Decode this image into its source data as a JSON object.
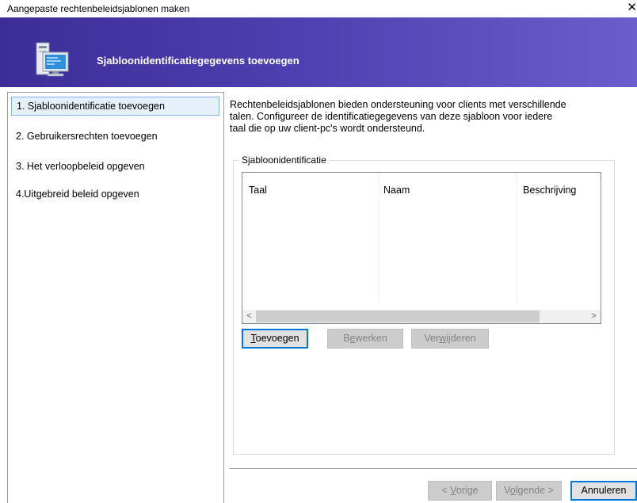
{
  "window": {
    "title": "Aangepaste rechtenbeleidsjablonen maken",
    "close_glyph": "✕"
  },
  "banner": {
    "icon": "computer-icon",
    "title": "Sjabloonidentificatiegegevens toevoegen",
    "gradient_start": "#3c2d97",
    "gradient_end": "#6b5dcc"
  },
  "sidebar": {
    "items": [
      {
        "label": "1. Sjabloonidentificatie toevoegen",
        "active": true
      },
      {
        "label": "2. Gebruikersrechten toevoegen",
        "active": false
      },
      {
        "label": "3. Het verloopbeleid opgeven",
        "active": false
      },
      {
        "label": "4.Uitgebreid beleid opgeven",
        "active": false
      }
    ]
  },
  "main": {
    "description_lines": [
      "Rechtenbeleidsjablonen bieden ondersteuning voor clients met verschillende",
      "talen. Configureer de identificatiegegevens van deze sjabloon voor iedere",
      "taal die op uw client-pc's wordt ondersteund."
    ],
    "group_label": "Sjabloonidentificatie",
    "columns": [
      "Taal",
      "Naam",
      "Beschrijving"
    ],
    "rows": [],
    "scroll_left": "<",
    "scroll_right": ">",
    "buttons": {
      "add": {
        "mnemonic": "T",
        "rest": "oevoegen",
        "enabled": true
      },
      "edit": {
        "before": "B",
        "mnemonic": "e",
        "rest": "werken",
        "enabled": false
      },
      "remove": {
        "before": "Ver",
        "mnemonic": "w",
        "rest": "ijderen",
        "enabled": false
      }
    }
  },
  "footer": {
    "prev": {
      "before": "< ",
      "mnemonic": "V",
      "rest": "orige",
      "enabled": false
    },
    "next": {
      "before": "V",
      "mnemonic": "o",
      "rest": "lgende >",
      "enabled": false
    },
    "cancel": {
      "label": "Annuleren",
      "enabled": true
    }
  }
}
